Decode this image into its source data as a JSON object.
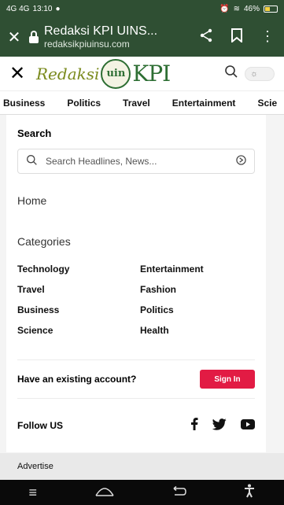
{
  "statusbar": {
    "signal": "4G 4G",
    "time": "13:10",
    "battery": "46%",
    "battery_level": 0.46
  },
  "browser": {
    "title": "Redaksi KPI UINS...",
    "url": "redaksikpiuinsu.com"
  },
  "site": {
    "logo_script": "Redaksi",
    "logo_seal": "uin",
    "logo_main": "KPI",
    "theme_icon": "☼"
  },
  "nav": {
    "items": [
      "Business",
      "Politics",
      "Travel",
      "Entertainment",
      "Scie"
    ]
  },
  "menu": {
    "search_label": "Search",
    "search_placeholder": "Search Headlines, News...",
    "home": "Home",
    "categories_label": "Categories",
    "categories": [
      "Technology",
      "Entertainment",
      "Travel",
      "Fashion",
      "Business",
      "Politics",
      "Science",
      "Health"
    ],
    "account_question": "Have an existing account?",
    "signin_label": "Sign In",
    "follow_label": "Follow US",
    "advertise": "Advertise"
  },
  "colors": {
    "chrome": "#2f4f33",
    "accent": "#e21b44",
    "brand_green": "#2d6e33"
  }
}
